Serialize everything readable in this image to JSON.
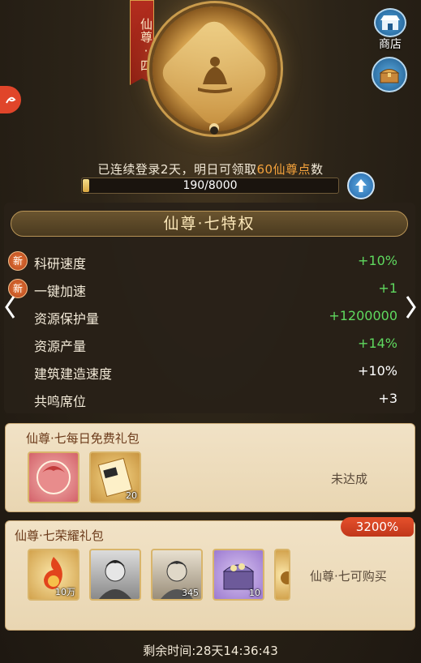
{
  "rank": {
    "badge_text": "仙尊·四"
  },
  "shop": {
    "label": "商店"
  },
  "login": {
    "prefix": "已连续登录2天，明日可领取",
    "highlight": "60仙尊点",
    "suffix": "数"
  },
  "progress": {
    "current": 190,
    "max": 8000,
    "text": "190/8000"
  },
  "privilege": {
    "title": "仙尊·七特权",
    "rows": [
      {
        "new_badge": "新",
        "label": "科研速度",
        "value": "+10%",
        "color": "green"
      },
      {
        "new_badge": "新",
        "label": "一键加速",
        "value": "+1",
        "color": "green"
      },
      {
        "new_badge": "",
        "label": "资源保护量",
        "value": "+1200000",
        "color": "green"
      },
      {
        "new_badge": "",
        "label": "资源产量",
        "value": "+14%",
        "color": "green"
      },
      {
        "new_badge": "",
        "label": "建筑建造速度",
        "value": "+10%",
        "color": "white"
      },
      {
        "new_badge": "",
        "label": "共鸣席位",
        "value": "+3",
        "color": "white"
      }
    ]
  },
  "daily_pack": {
    "title": "仙尊·七每日免费礼包",
    "items": [
      {
        "icon": "avatar-frame-icon",
        "count": ""
      },
      {
        "icon": "scroll-icon",
        "count": "20"
      }
    ],
    "status": "未达成"
  },
  "honor_pack": {
    "title": "仙尊·七荣耀礼包",
    "percent": "3200%",
    "items": [
      {
        "icon": "flame-orb-icon",
        "count": "10万"
      },
      {
        "icon": "hero-portrait-icon",
        "count": ""
      },
      {
        "icon": "hero-portrait-icon",
        "count": "345"
      },
      {
        "icon": "treasure-chest-icon",
        "count": "10"
      },
      {
        "icon": "partial-item-icon",
        "count": ""
      }
    ],
    "status": "仙尊·七可购买"
  },
  "timer": {
    "text": "剩余时间:28天14:36:43"
  },
  "colors": {
    "accent_gold": "#d9a640",
    "green_value": "#5fd95f",
    "badge_red": "#c0361a",
    "highlight_orange": "#f3a13b"
  }
}
